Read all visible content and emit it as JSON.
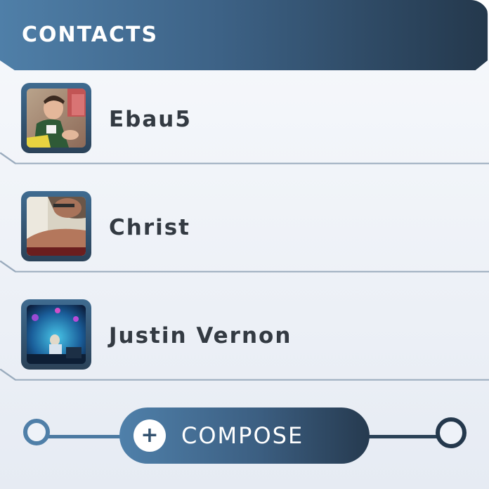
{
  "header": {
    "title": "CONTACTS"
  },
  "contacts": [
    {
      "name": "Ebau5"
    },
    {
      "name": "Christ"
    },
    {
      "name": "Justin Vernon"
    }
  ],
  "compose": {
    "label": "COMPOSE",
    "icon": "plus-icon"
  },
  "colors": {
    "accent_start": "#4f7fa8",
    "accent_end": "#24384c",
    "name_text": "#333a42",
    "divider": "#9aabbd"
  }
}
